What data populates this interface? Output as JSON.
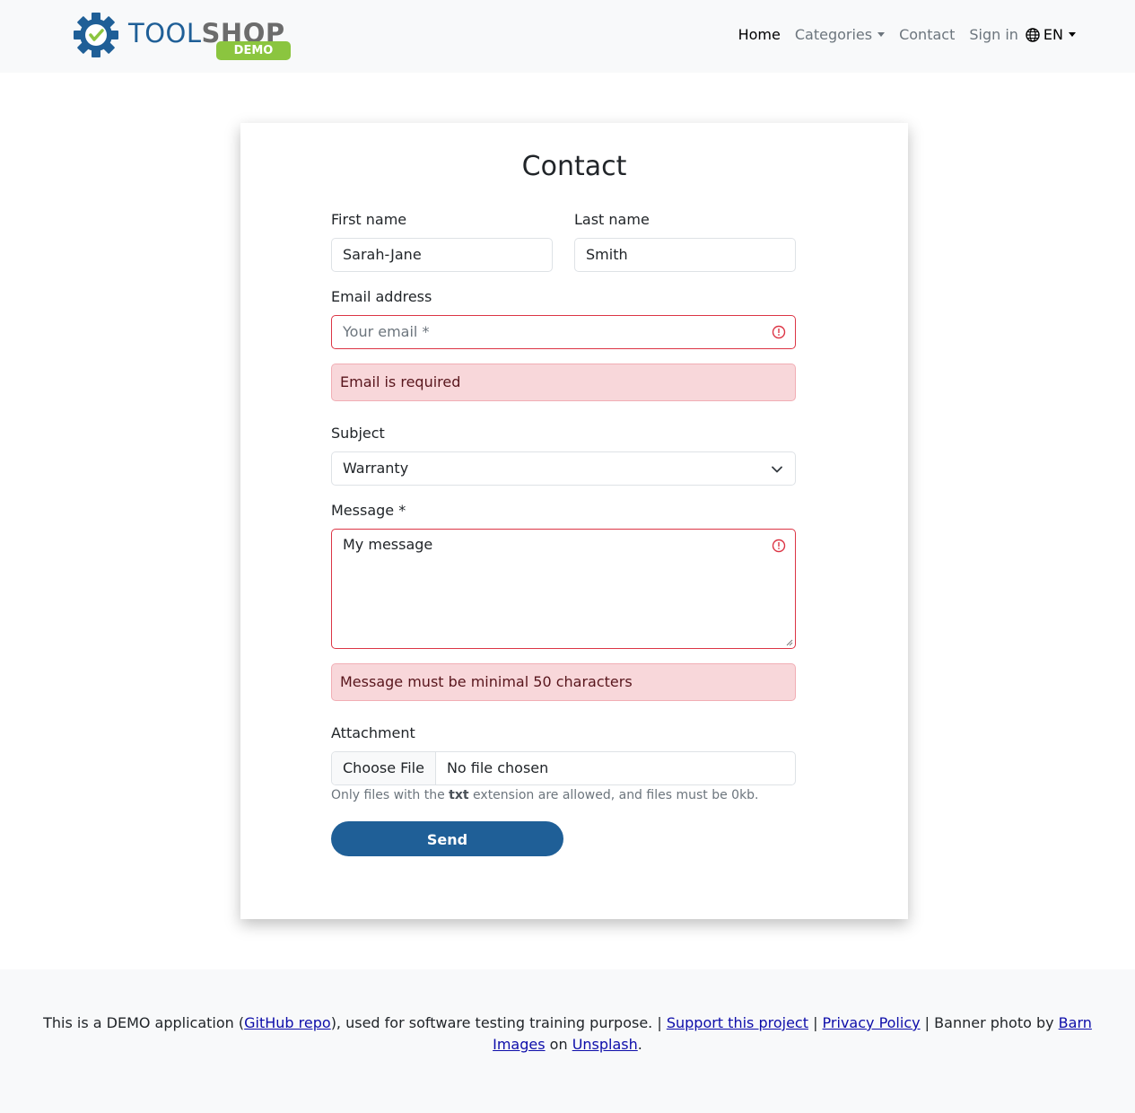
{
  "brand": {
    "word1": "TOOL",
    "word2": "SHOP",
    "badge": "DEMO"
  },
  "nav": {
    "home": "Home",
    "categories": "Categories",
    "contact": "Contact",
    "signin": "Sign in",
    "language": "EN"
  },
  "form": {
    "title": "Contact",
    "first_name_label": "First name",
    "first_name_value": "Sarah-Jane",
    "last_name_label": "Last name",
    "last_name_value": "Smith",
    "email_label": "Email address",
    "email_placeholder": "Your email *",
    "email_error": "Email is required",
    "subject_label": "Subject",
    "subject_value": "Warranty",
    "message_label": "Message *",
    "message_value": "My message",
    "message_error": "Message must be minimal 50 characters",
    "attachment_label": "Attachment",
    "choose_file": "Choose File",
    "no_file": "No file chosen",
    "hint_before": "Only files with the ",
    "hint_bold": "txt",
    "hint_after": " extension are allowed, and files must be 0kb.",
    "send_label": "Send"
  },
  "footer": {
    "t1": "This is a DEMO application (",
    "github": "GitHub repo",
    "t2": "), used for software testing training purpose. | ",
    "support": "Support this project",
    "t3": " | ",
    "privacy": "Privacy Policy",
    "t4": " | Banner photo by ",
    "barn1": "Barn",
    "barn2": "Images",
    "t5": " on ",
    "unsplash": "Unsplash",
    "t6": "."
  },
  "colors": {
    "brand_blue": "#1f5f97",
    "brand_green": "#8bc53f",
    "error_red": "#dc3545",
    "alert_bg": "#f8d7da"
  }
}
